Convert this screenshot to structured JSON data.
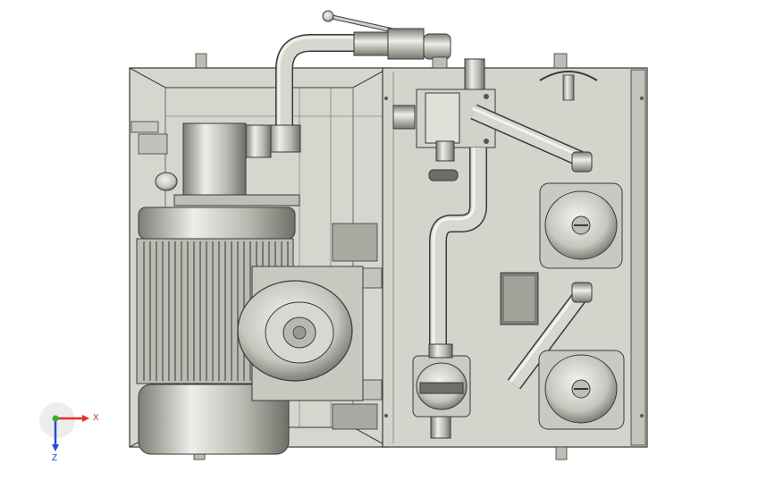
{
  "viewport": {
    "background": "#ffffff",
    "colors": {
      "panel": "#d9d9d2",
      "panel_dark": "#b9b9b1",
      "steel": "#cfcfc8",
      "steel_dark": "#8b8b84",
      "line": "#3a3a36"
    }
  },
  "triad": {
    "x_label": "X",
    "z_label": "Z",
    "x_color": "#e0302a",
    "y_color": "#2db52d",
    "z_color": "#2a49d8"
  }
}
